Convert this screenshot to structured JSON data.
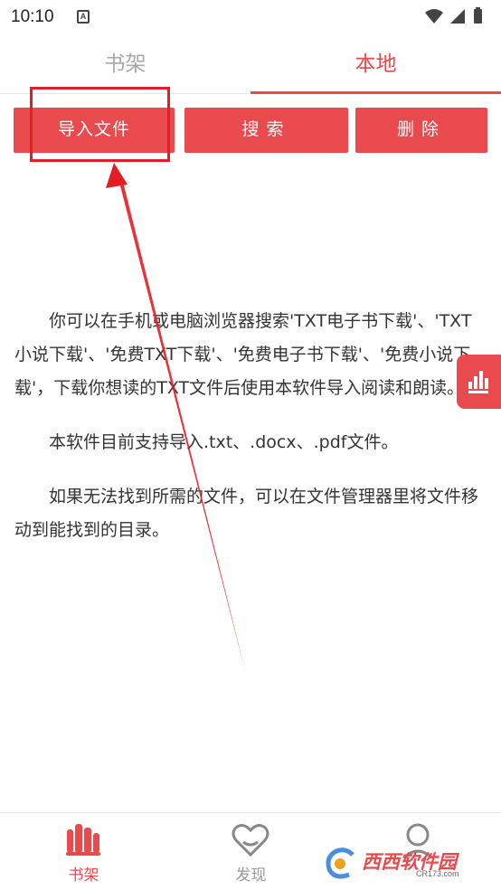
{
  "status_bar": {
    "time": "10:10",
    "notification_glyph": "A"
  },
  "tabs": [
    {
      "label": "书架",
      "active": false
    },
    {
      "label": "本地",
      "active": true
    }
  ],
  "actions": {
    "import_label": "导入文件",
    "search_label": "搜索",
    "delete_label": "删除"
  },
  "instructions": [
    "你可以在手机或电脑浏览器搜索'TXT电子书下载'、'TXT小说下载'、'免费TXT下载'、'免费电子书下载'、'免费小说下载'，下载你想读的TXT文件后使用本软件导入阅读和朗读。",
    "本软件目前支持导入.txt、.docx、.pdf文件。",
    "如果无法找到所需的文件，可以在文件管理器里将文件移动到能找到的目录。"
  ],
  "bottom_nav": [
    {
      "label": "书架",
      "icon": "bookshelf-icon",
      "active": true
    },
    {
      "label": "发现",
      "icon": "heart-discover-icon",
      "active": false
    },
    {
      "label": "",
      "icon": "person-icon",
      "active": false
    }
  ],
  "watermark": {
    "text": "西西软件园",
    "sub": "CR173.com"
  },
  "colors": {
    "accent": "#e84a4e",
    "annotation": "#e31d24",
    "inactive": "#a8a8a8"
  }
}
